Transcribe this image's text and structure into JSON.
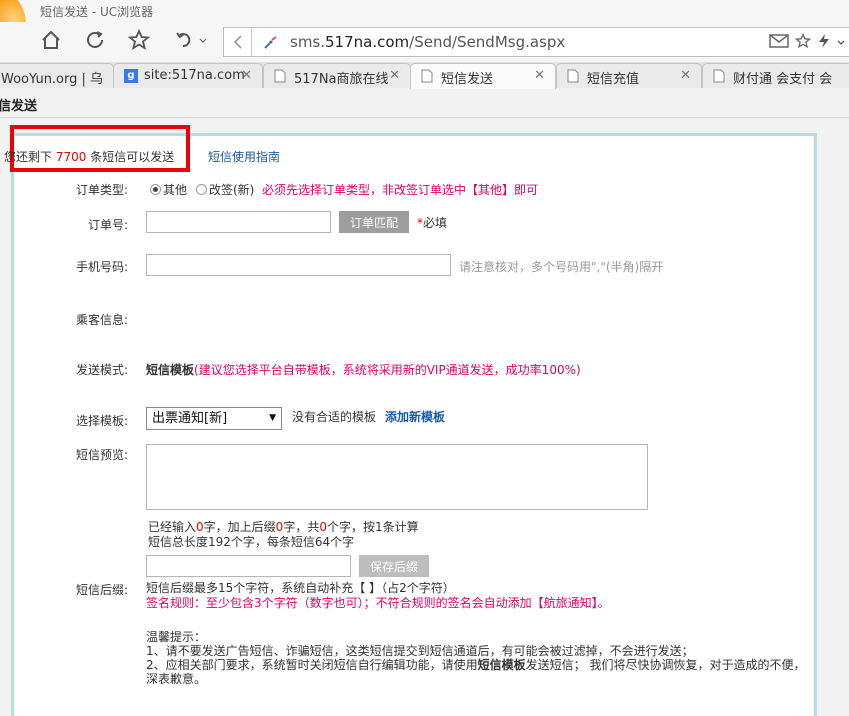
{
  "browser": {
    "title": "短信发送 - UC浏览器",
    "url_prefix": "sms.",
    "url_domain": "517na.com",
    "url_path": "/Send/SendMsg.aspx",
    "tabs": [
      {
        "label": "WooYun.org | 乌"
      },
      {
        "label": "site:517na.com"
      },
      {
        "label": "517Na商旅在线"
      },
      {
        "label": "短信发送"
      },
      {
        "label": "短信充值"
      },
      {
        "label": "财付通 会支付 会"
      }
    ],
    "page_heading": "信发送"
  },
  "header": {
    "remain_prefix": "您还剩下 ",
    "remain_count": "7700",
    "remain_suffix": " 条短信可以发送",
    "guide_link": "短信使用指南"
  },
  "form": {
    "order_type_label": "订单类型:",
    "order_type_options": [
      "其他",
      "改签(新)"
    ],
    "order_type_note": "必须先选择订单类型，非改签订单选中【其他】即可",
    "order_no_label": "订单号:",
    "order_match_btn": "订单匹配",
    "required_star": "*",
    "required_text": "必填",
    "phone_label": "手机号码:",
    "phone_hint": "请注意核对，多个号码用\",\"(半角)隔开",
    "passenger_label": "乘客信息:",
    "mode_label": "发送模式:",
    "mode_value": "短信模板",
    "mode_note": "(建议您选择平台自带模板，系统将采用新的VIP通道发送，成功率100%)",
    "template_label": "选择模板:",
    "template_selected": "出票通知[新]",
    "no_template_text": "没有合适的模板",
    "add_template_link": "添加新模板",
    "preview_label": "短信预览:",
    "count_line": {
      "p1": "已经输入",
      "v1": "0",
      "p2": "字，加上后缀",
      "v2": "0",
      "p3": "字，共",
      "v3": "0",
      "p4": "个字，按",
      "v4": "1",
      "p5": "条计算"
    },
    "length_line": "短信总长度192个字，每条短信64个字",
    "save_suffix_btn": "保存后缀",
    "suffix_label": "短信后缀:",
    "suffix_note": "短信后缀最多15个字符，系统自动补充【 】（占2个字符）",
    "sign_rule": "签名规则：至少包含3个字符（数字也可）；不符合规则的签名会自动添加【航旅通知】。",
    "tips_title": "温馨提示：",
    "tip1": "1、请不要发送广告短信、诈骗短信，这类短信提交到短信通道后，有可能会被过滤掉，不会进行发送；",
    "tip2_a": "2、应相关部门要求，系统暂时关闭短信自行编辑功能，请使用",
    "tip2_bold": "短信模板",
    "tip2_b": "发送短信； 我们将尽快协调恢复，对于造成的不便，",
    "tip2_c": "深表歉意。"
  }
}
